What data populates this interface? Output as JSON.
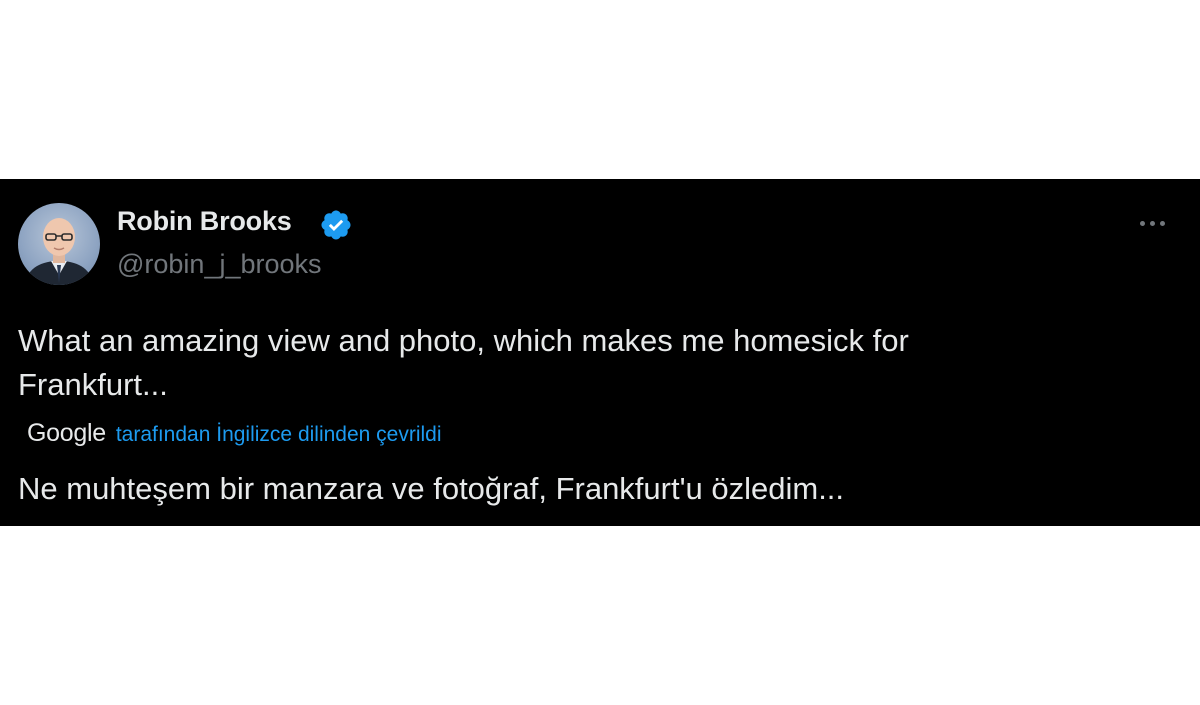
{
  "tweet": {
    "author": {
      "display_name": "Robin Brooks",
      "handle": "@robin_j_brooks",
      "verified": true,
      "avatar_icon": "profile-photo"
    },
    "body_line1": "What an amazing view and photo, which makes me homesick for",
    "body_line2": "Frankfurt...",
    "translation": {
      "provider": "Google",
      "label": "tarafından İngilizce dilinden çevrildi",
      "text": "Ne muhteşem bir manzara ve fotoğraf, Frankfurt'u özledim..."
    },
    "menu_icon": "more-horizontal-icon"
  },
  "colors": {
    "background": "#000000",
    "text": "#e7e9ea",
    "secondary": "#71767b",
    "accent": "#1d9bf0",
    "page": "#ffffff"
  }
}
